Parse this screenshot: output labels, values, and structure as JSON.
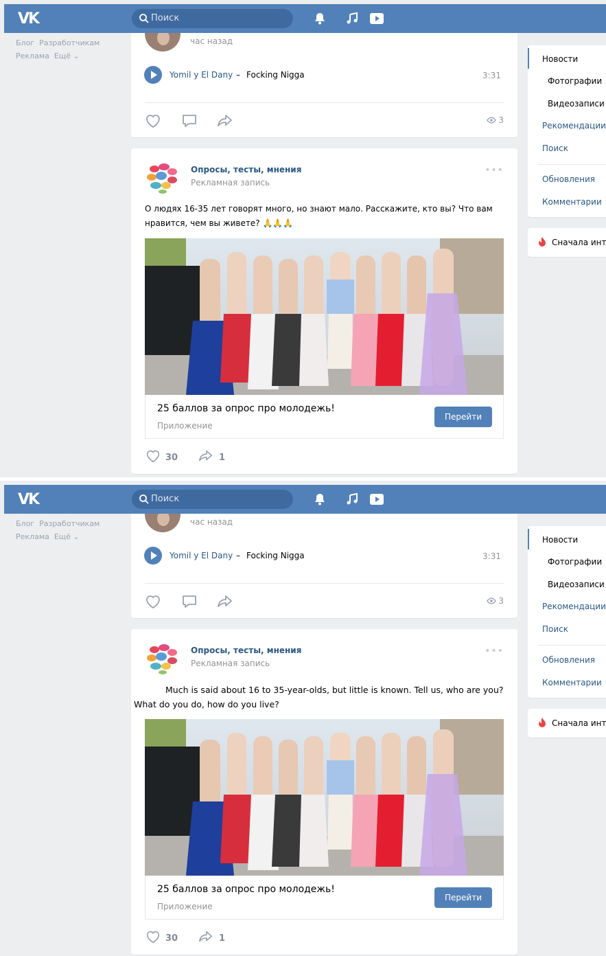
{
  "header": {
    "logo": "VK",
    "search_placeholder": "Поиск"
  },
  "left_links": [
    "Блог",
    "Разработчикам",
    "Реклама",
    "Ещё ⌄"
  ],
  "music_post": {
    "time": "час назад",
    "artist": "Yomil y El Dany",
    "separator": "–",
    "track": "Focking Nigga",
    "duration": "3:31",
    "views": "3"
  },
  "ad_post": {
    "group_name": "Опросы, тесты, мнения",
    "subtitle": "Рекламная запись",
    "more": "•••",
    "text_original": "О людях 16-35 лет говорят много, но знают мало. Расскажите, кто вы? Что вам нравится, чем вы живете? 🙏🙏🙏",
    "text_translated": "Much is said about 16 to 35-year-olds, but little is known. Tell us, who are you? What do you do, how do you live?",
    "card_title": "25 баллов за опрос про молодежь!",
    "card_sub": "Приложение",
    "card_button": "Перейти",
    "likes": "30",
    "shares": "1"
  },
  "right_menu": {
    "items": [
      "Новости",
      "Фотографии",
      "Видеозаписи",
      "Рекомендации",
      "Поиск",
      "Обновления",
      "Комментарии"
    ],
    "sort_label": "Сначала интересные"
  },
  "colors": {
    "vk_blue": "#5181b8",
    "link": "#2a5885",
    "bg": "#edeef0"
  }
}
